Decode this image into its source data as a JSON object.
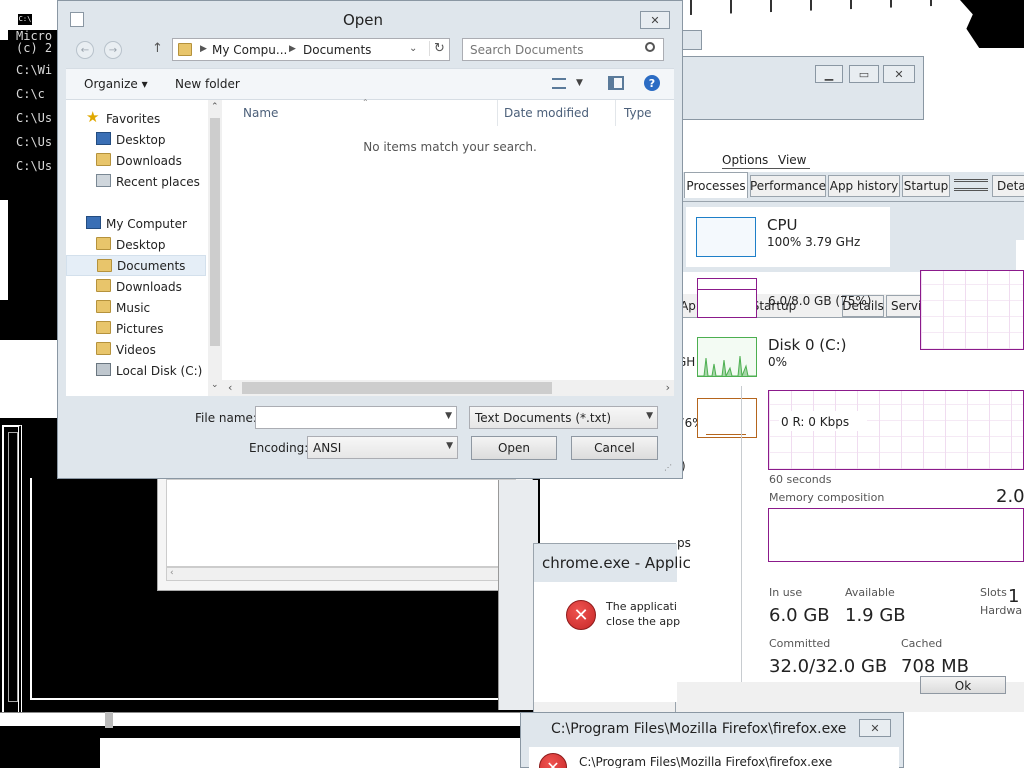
{
  "console": {
    "lines": [
      "Micro",
      "(c) 2",
      "C:\\Wi",
      "C:\\c",
      "C:\\Us",
      "C:\\Us",
      "C:\\Us"
    ]
  },
  "open_dialog": {
    "title": "Open",
    "close_label": "✕",
    "breadcrumb": [
      "My Compu...",
      "Documents"
    ],
    "search_placeholder": "Search Documents",
    "organize_label": "Organize ▾",
    "new_folder_label": "New folder",
    "favorites_label": "Favorites",
    "favorites": [
      "Desktop",
      "Downloads",
      "Recent places"
    ],
    "computer_label": "My Computer",
    "computer_items": [
      "Desktop",
      "Documents",
      "Downloads",
      "Music",
      "Pictures",
      "Videos",
      "Local Disk (C:)"
    ],
    "columns": [
      "Name",
      "Date modified",
      "Type"
    ],
    "empty_message": "No items match your search.",
    "file_name_label": "File name:",
    "file_name_value": "",
    "file_type_value": "Text Documents (*.txt)",
    "encoding_label": "Encoding:",
    "encoding_value": "ANSI",
    "open_button": "Open",
    "cancel_button": "Cancel"
  },
  "task_manager": {
    "menu": [
      "Options",
      "View"
    ],
    "tabs": [
      "Processes",
      "Performance",
      "App history",
      "Startup",
      "Detai"
    ],
    "under_tabs": [
      "Ap",
      "Startup",
      "Details",
      "Servic"
    ],
    "cpu_title": "CPU",
    "cpu_value": "100% 3.79 GHz",
    "memory_value": "6.0/8.0 GB (75%)",
    "disk_title": "Disk 0 (C:)",
    "disk_value": "0%",
    "side_values": [
      "GH",
      "76%",
      ":)",
      "ps"
    ],
    "network_value": "0 R: 0 Kbps",
    "seconds_label": "60 seconds",
    "memory_composition_label": "Memory composition",
    "memory_total": "2.0",
    "in_use_label": "In use",
    "in_use_value": "6.0 GB",
    "available_label": "Available",
    "available_value": "1.9 GB",
    "slots_label": "Slots",
    "slots_value": "1",
    "hardware_label": "Hardwa",
    "committed_label": "Committed",
    "committed_value": "32.0/32.0 GB",
    "cached_label": "Cached",
    "cached_value": "708 MB",
    "ok_partial": "Ok"
  },
  "chrome_error": {
    "title": "chrome.exe - Applic",
    "line1": "The applicati",
    "line2": "close the app"
  },
  "firefox_error": {
    "title": "C:\\Program Files\\Mozilla Firefox\\firefox.exe",
    "close_label": "✕",
    "body": "C:\\Program Files\\Mozilla Firefox\\firefox.exe"
  },
  "colors": {
    "memory_accent": "#8b1a8b",
    "disk_accent": "#4caf50",
    "ethernet_accent": "#b5651d",
    "cpu_accent": "#1e7fc8",
    "error_red": "#c62828"
  }
}
